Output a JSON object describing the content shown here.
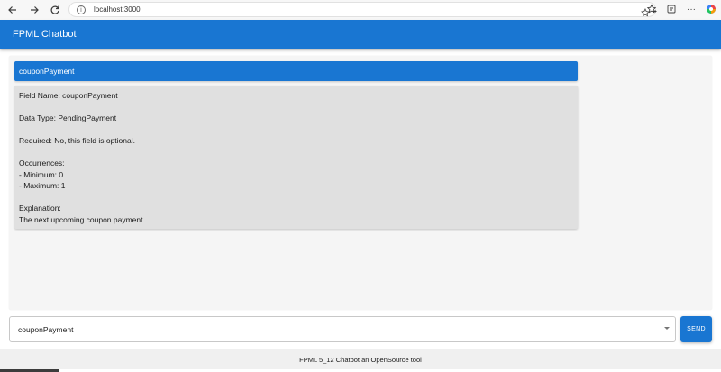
{
  "browser": {
    "url": "localhost:3000",
    "icons": [
      "back-icon",
      "forward-icon",
      "reload-icon",
      "info-icon",
      "star-icon",
      "collections-icon",
      "favorites-icon",
      "more-icon",
      "copilot-icon"
    ],
    "more_label": "···"
  },
  "app": {
    "title": "FPML Chatbot",
    "brand_color": "#1976d2"
  },
  "chat": {
    "user_message": "couponPayment",
    "bot_lines": [
      "Field Name: couponPayment",
      "",
      "Data Type: PendingPayment",
      "",
      "Required: No, this field is optional.",
      "",
      "Occurrences:",
      "- Minimum: 0",
      "- Maximum: 1",
      "",
      "Explanation:",
      "The next upcoming coupon payment."
    ]
  },
  "input": {
    "value": "couponPayment",
    "send_label": "SEND"
  },
  "footer": {
    "text": "FPML 5_12 Chatbot an OpenSource tool"
  }
}
